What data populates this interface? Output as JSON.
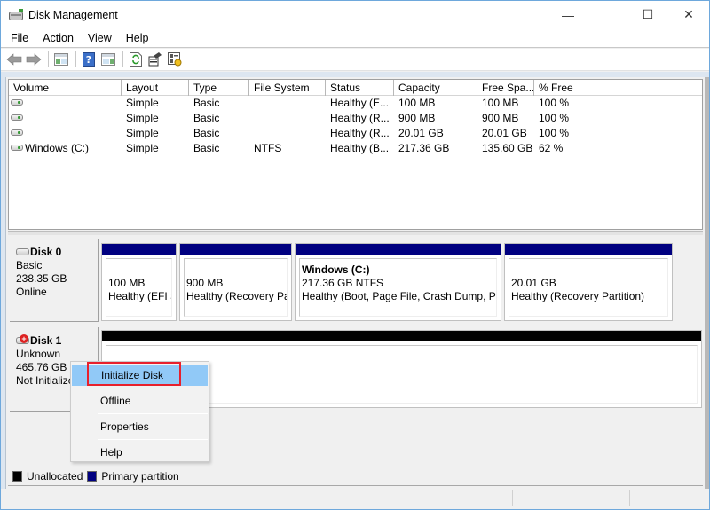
{
  "window": {
    "title": "Disk Management",
    "icon": "disk-management-icon",
    "controls": {
      "minimize": "—",
      "maximize": "☐",
      "close": "✕"
    }
  },
  "menubar": {
    "items": [
      {
        "label": "File"
      },
      {
        "label": "Action"
      },
      {
        "label": "View"
      },
      {
        "label": "Help"
      }
    ]
  },
  "toolbar": {
    "buttons": [
      {
        "name": "back",
        "icon": "back-arrow-icon"
      },
      {
        "name": "forward",
        "icon": "forward-arrow-icon"
      },
      {
        "name": "show-hide-console-tree",
        "icon": "console-tree-icon"
      },
      {
        "name": "help",
        "icon": "help-icon"
      },
      {
        "name": "show-hide-action-pane",
        "icon": "action-pane-icon"
      },
      {
        "name": "refresh",
        "icon": "refresh-icon"
      },
      {
        "name": "properties",
        "icon": "properties-icon"
      },
      {
        "name": "rescan-disks",
        "icon": "rescan-icon"
      }
    ]
  },
  "volume_list": {
    "columns": [
      "Volume",
      "Layout",
      "Type",
      "File System",
      "Status",
      "Capacity",
      "Free Spa...",
      "% Free"
    ],
    "rows": [
      {
        "volume": "",
        "layout": "Simple",
        "type": "Basic",
        "file_system": "",
        "status": "Healthy (E...",
        "capacity": "100 MB",
        "free_space": "100 MB",
        "percent_free": "100 %"
      },
      {
        "volume": "",
        "layout": "Simple",
        "type": "Basic",
        "file_system": "",
        "status": "Healthy (R...",
        "capacity": "900 MB",
        "free_space": "900 MB",
        "percent_free": "100 %"
      },
      {
        "volume": "",
        "layout": "Simple",
        "type": "Basic",
        "file_system": "",
        "status": "Healthy (R...",
        "capacity": "20.01 GB",
        "free_space": "20.01 GB",
        "percent_free": "100 %"
      },
      {
        "volume": "Windows (C:)",
        "layout": "Simple",
        "type": "Basic",
        "file_system": "NTFS",
        "status": "Healthy (B...",
        "capacity": "217.36 GB",
        "free_space": "135.60 GB",
        "percent_free": "62 %"
      }
    ]
  },
  "disks": [
    {
      "name": "Disk 0",
      "type": "Basic",
      "size": "238.35 GB",
      "state": "Online",
      "partitions": [
        {
          "title": "",
          "size": "100 MB",
          "status": "Healthy (EFI S"
        },
        {
          "title": "",
          "size": "900 MB",
          "status": "Healthy (Recovery Par"
        },
        {
          "title": "Windows  (C:)",
          "size": "217.36 GB NTFS",
          "status": "Healthy (Boot, Page File, Crash Dump, Prir"
        },
        {
          "title": "",
          "size": "20.01 GB",
          "status": "Healthy (Recovery Partition)"
        }
      ]
    },
    {
      "name": "Disk 1",
      "type": "Unknown",
      "size": "465.76 GB",
      "state": "Not Initialize"
    }
  ],
  "context_menu": {
    "items": [
      {
        "label": "Initialize Disk",
        "highlighted": true
      },
      {
        "label": "Offline"
      },
      {
        "label": "Properties"
      },
      {
        "label": "Help"
      }
    ]
  },
  "legend": {
    "items": [
      {
        "label": "Unallocated",
        "color": "#000000"
      },
      {
        "label": "Primary partition",
        "color": "#000080"
      }
    ]
  },
  "colors": {
    "primary_partition": "#000080",
    "unallocated": "#000000",
    "menu_highlight": "#91c9f7",
    "annotation": "#e8202c"
  }
}
